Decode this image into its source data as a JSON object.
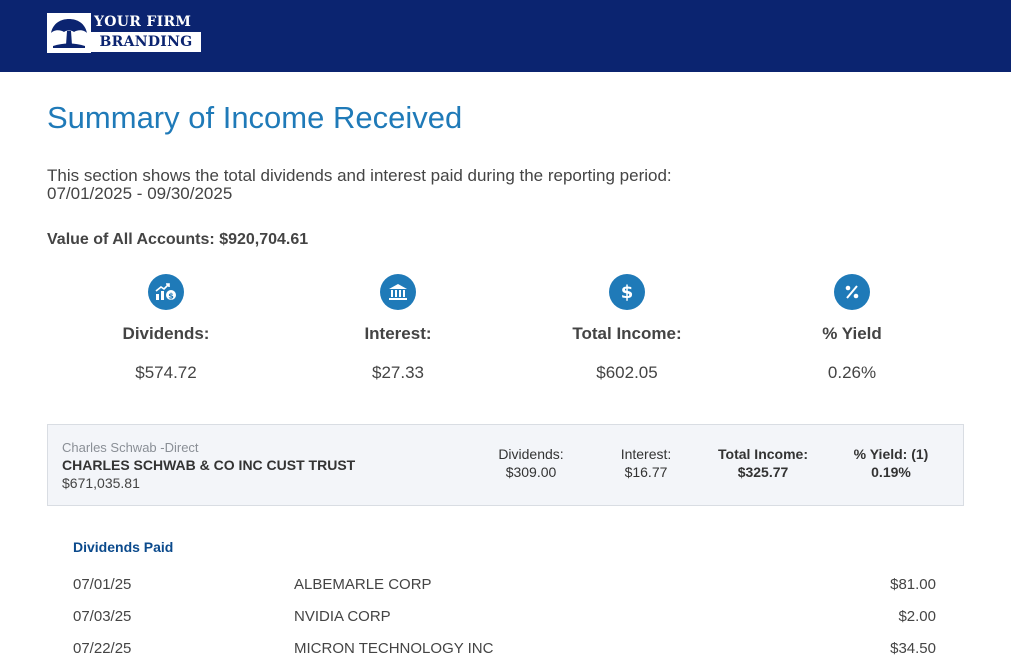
{
  "brand": {
    "line1": "YOUR FIRM",
    "line2": "BRANDING",
    "header_color": "#0b2470",
    "logo_icon": "tree-icon"
  },
  "page": {
    "title": "Summary of Income Received",
    "description": "This section shows the total dividends and interest paid during the reporting period:",
    "period": "07/01/2025 - 09/30/2025",
    "accounts_value_label": "Value of All Accounts:",
    "accounts_value": "$920,704.61",
    "accent_color": "#1f7ab8"
  },
  "summary": [
    {
      "icon": "chart-dollar-icon",
      "label": "Dividends:",
      "value": "$574.72"
    },
    {
      "icon": "bank-icon",
      "label": "Interest:",
      "value": "$27.33"
    },
    {
      "icon": "dollar-icon",
      "label": "Total Income:",
      "value": "$602.05"
    },
    {
      "icon": "percent-icon",
      "label": "% Yield",
      "value": "0.26%"
    }
  ],
  "account": {
    "source": "Charles Schwab -Direct",
    "name": "CHARLES SCHWAB & CO INC CUST TRUST",
    "value": "$671,035.81",
    "dividends_label": "Dividends:",
    "dividends": "$309.00",
    "interest_label": "Interest:",
    "interest": "$16.77",
    "total_label": "Total Income:",
    "total": "$325.77",
    "yield_label": "% Yield: (1)",
    "yield": "0.19%"
  },
  "dividends_paid": {
    "title": "Dividends Paid",
    "rows": [
      {
        "date": "07/01/25",
        "description": "ALBEMARLE CORP",
        "amount": "$81.00"
      },
      {
        "date": "07/03/25",
        "description": "NVIDIA CORP",
        "amount": "$2.00"
      },
      {
        "date": "07/22/25",
        "description": "MICRON TECHNOLOGY INC",
        "amount": "$34.50"
      }
    ]
  }
}
